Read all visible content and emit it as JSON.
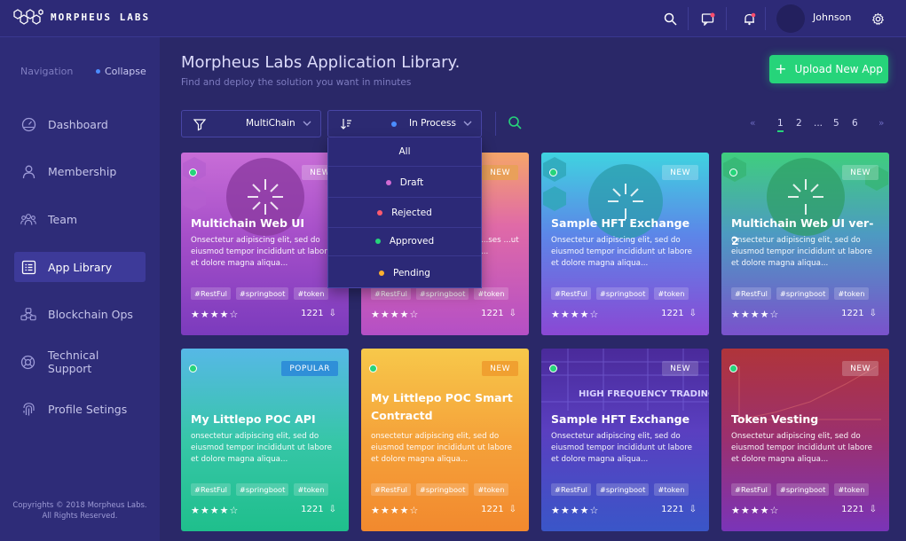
{
  "brand": {
    "name": "MORPHEUS LABS"
  },
  "header": {
    "username": "Johnson"
  },
  "sidebar": {
    "nav_label": "Navigation",
    "collapse_label": "Collapse",
    "items": [
      {
        "label": "Dashboard",
        "icon": "dashboard-icon"
      },
      {
        "label": "Membership",
        "icon": "user-icon"
      },
      {
        "label": "Team",
        "icon": "team-icon"
      },
      {
        "label": "App Library",
        "icon": "list-icon"
      },
      {
        "label": "Blockchain Ops",
        "icon": "blockchain-icon"
      },
      {
        "label": "Technical Support",
        "icon": "support-icon"
      },
      {
        "label": "Profile Setings",
        "icon": "fingerprint-icon"
      }
    ],
    "copyright_line1": "Copyrights © 2018 Morpheus Labs.",
    "copyright_line2": "All Rights Reserved."
  },
  "main": {
    "title": "Morpheus Labs Application Library.",
    "subtitle": "Find and deploy the solution you want in minutes",
    "upload_label": "Upload New App"
  },
  "filters": {
    "chain": "MultiChain",
    "status": "In Process",
    "status_options": [
      {
        "label": "All",
        "color": ""
      },
      {
        "label": "Draft",
        "color": "#d36bd4"
      },
      {
        "label": "Rejected",
        "color": "#ff5a6e"
      },
      {
        "label": "Approved",
        "color": "#26d47a"
      },
      {
        "label": "Pending",
        "color": "#ffb02e"
      }
    ]
  },
  "pagination": {
    "pages": [
      "1",
      "2",
      "...",
      "5",
      "6"
    ],
    "current": "1"
  },
  "colors": {
    "accent": "#26d47a",
    "background": "#2a2868",
    "sidebar": "#2e2c78"
  },
  "cards": [
    {
      "title": "Multichain Web UI",
      "badge": "NEW",
      "description": "Onsectetur adipiscing elit, sed do eiusmod tempor incididunt ut labore et dolore magna aliqua...",
      "tags": [
        "#RestFul",
        "#springboot",
        "#token"
      ],
      "rating": 4,
      "downloads": "1221"
    },
    {
      "title": "",
      "badge": "NEW",
      "description": "...ses ...ut ...",
      "tags": [
        "#RestFul",
        "#springboot",
        "#token"
      ],
      "rating": 4,
      "downloads": "1221"
    },
    {
      "title": "Sample HFT Exchange",
      "badge": "NEW",
      "description": "Onsectetur adipiscing elit, sed do eiusmod tempor incididunt ut labore et dolore magna aliqua...",
      "tags": [
        "#RestFul",
        "#springboot",
        "#token"
      ],
      "rating": 4,
      "downloads": "1221"
    },
    {
      "title": "Multichain Web UI ver-2",
      "badge": "NEW",
      "description": "Onsectetur adipiscing elit, sed do eiusmod tempor incididunt ut labore et dolore magna aliqua...",
      "tags": [
        "#RestFul",
        "#springboot",
        "#token"
      ],
      "rating": 4,
      "downloads": "1221"
    },
    {
      "title": "My Littlepo POC API",
      "badge": "POPULAR",
      "description": "onsectetur adipiscing elit, sed do eiusmod tempor incididunt ut labore et dolore magna aliqua...",
      "tags": [
        "#RestFul",
        "#springboot",
        "#token"
      ],
      "rating": 4,
      "downloads": "1221"
    },
    {
      "title": "My Littlepo POC Smart Contractd",
      "badge": "NEW",
      "description": "onsectetur adipiscing elit, sed do eiusmod tempor incididunt ut labore et dolore magna aliqua...",
      "tags": [
        "#RestFul",
        "#springboot",
        "#token"
      ],
      "rating": 4,
      "downloads": "1221"
    },
    {
      "title": "Sample HFT Exchange",
      "badge": "NEW",
      "description": "Onsectetur adipiscing elit, sed do eiusmod tempor incididunt ut labore et dolore magna aliqua...",
      "tags": [
        "#RestFul",
        "#springboot",
        "#token"
      ],
      "rating": 4,
      "downloads": "1221",
      "art_text": "HIGH FREQUENCY TRADING"
    },
    {
      "title": "Token Vesting",
      "badge": "NEW",
      "description": "Onsectetur adipiscing elit, sed do eiusmod tempor incididunt ut labore et dolore magna aliqua...",
      "tags": [
        "#RestFul",
        "#springboot",
        "#token"
      ],
      "rating": 4,
      "downloads": "1221"
    }
  ]
}
